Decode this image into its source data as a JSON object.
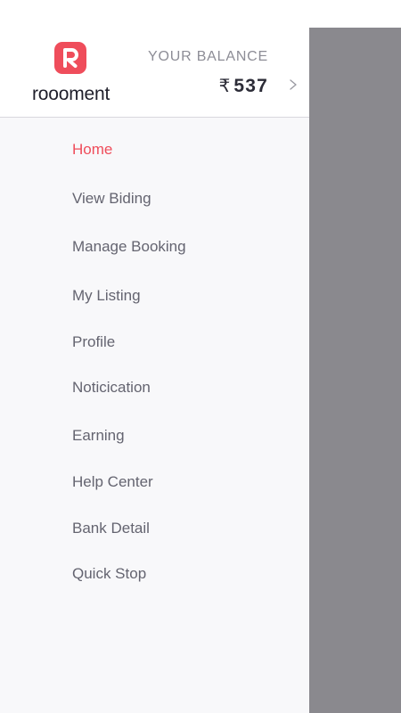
{
  "brand": {
    "name": "roooment",
    "logo_icon": "r-logo-icon",
    "accent_color": "#ef4d5b"
  },
  "balance": {
    "label": "YOUR BALANCE",
    "currency_symbol": "₹",
    "amount": "537",
    "chevron_icon": "chevron-right-icon"
  },
  "menu": {
    "active_index": 0,
    "items": [
      {
        "label": "Home"
      },
      {
        "label": "View Biding"
      },
      {
        "label": "Manage Booking"
      },
      {
        "label": "My Listing"
      },
      {
        "label": "Profile"
      },
      {
        "label": "Noticication"
      },
      {
        "label": "Earning"
      },
      {
        "label": "Help Center"
      },
      {
        "label": "Bank Detail"
      },
      {
        "label": "Quick Stop"
      }
    ]
  },
  "colors": {
    "overlay": "#8a898e",
    "menu_text": "#646470",
    "drawer_background": "#f8f8fa"
  }
}
